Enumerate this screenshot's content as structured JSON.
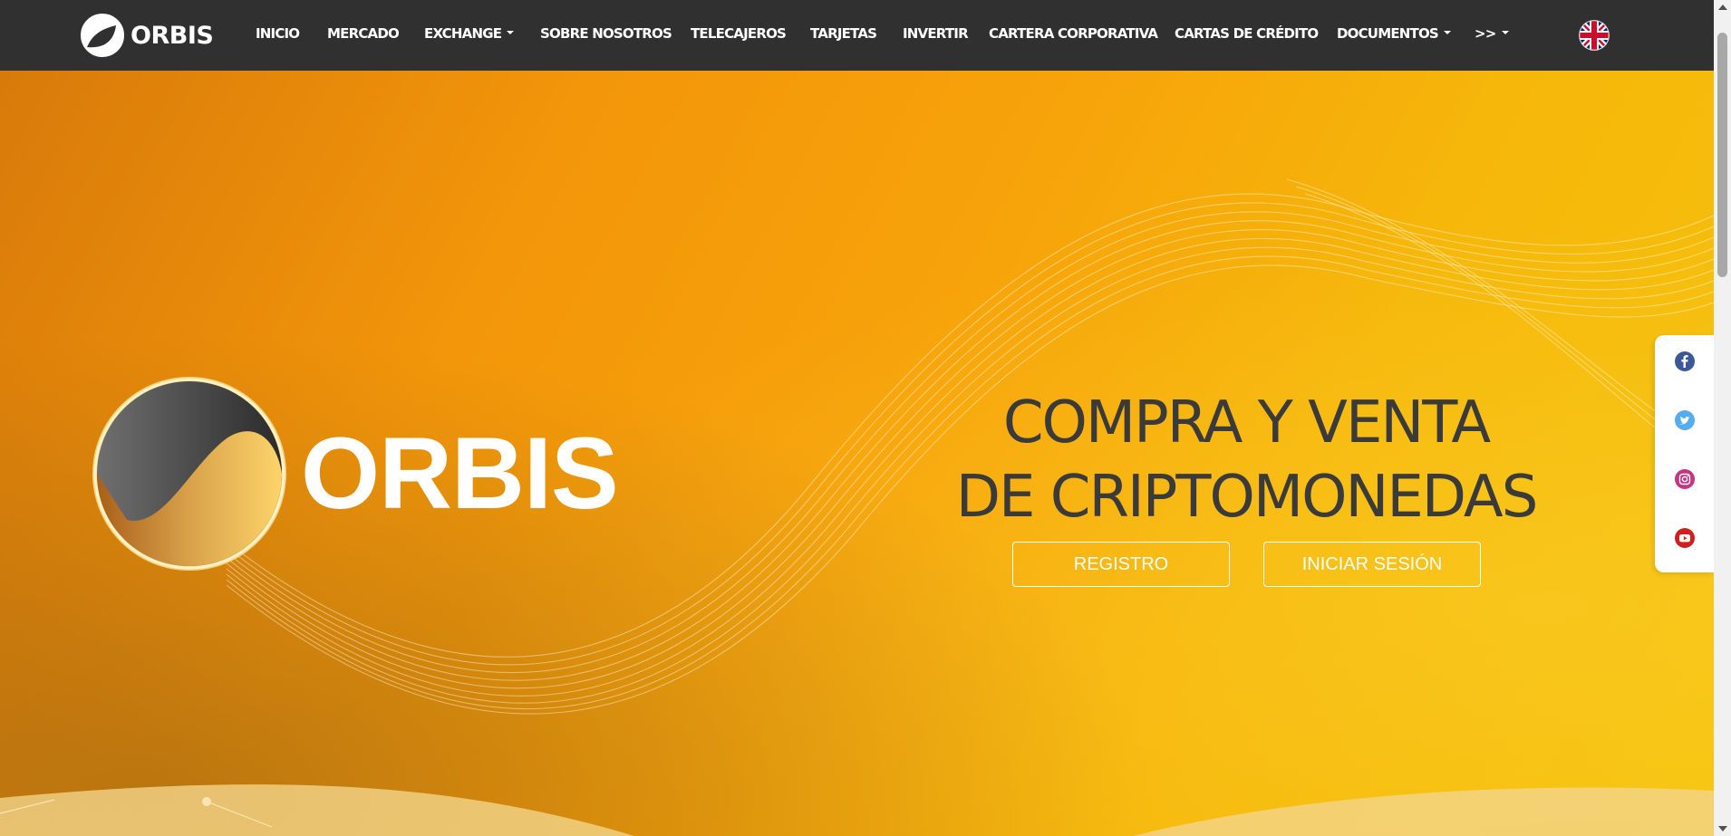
{
  "brand": {
    "name": "ORBIS",
    "logo_icon": "orbis-logo-icon"
  },
  "nav": {
    "items": [
      {
        "label": "INICIO",
        "dropdown": false
      },
      {
        "label": "MERCADO",
        "dropdown": false
      },
      {
        "label": "EXCHANGE",
        "dropdown": true
      },
      {
        "label": "SOBRE NOSOTROS",
        "dropdown": false
      },
      {
        "label": "TELECAJEROS",
        "dropdown": false
      },
      {
        "label": "TARJETAS",
        "dropdown": false
      },
      {
        "label": "INVERTIR",
        "dropdown": false
      },
      {
        "label": "CARTERA CORPORATIVA",
        "dropdown": false
      },
      {
        "label": "CARTAS DE CRÉDITO",
        "dropdown": false
      },
      {
        "label": "DOCUMENTOS",
        "dropdown": true
      },
      {
        "label": ">>",
        "dropdown": true
      }
    ],
    "language_icon": "uk-flag-icon"
  },
  "hero": {
    "logo_word": "ORBIS",
    "headline_line1": "COMPRA Y VENTA",
    "headline_line2": "DE CRIPTOMONEDAS",
    "register_label": "REGISTRO",
    "login_label": "INICIAR SESIÓN"
  },
  "social": [
    {
      "icon": "facebook-icon",
      "color": "#3b5998"
    },
    {
      "icon": "twitter-icon",
      "color": "#55acee"
    },
    {
      "icon": "instagram-icon",
      "color": "#c13584"
    },
    {
      "icon": "youtube-icon",
      "color": "#cd201f"
    }
  ],
  "colors": {
    "navbar": "#303030",
    "hero_orange": "#f3960a",
    "hero_yellow": "#f5c30c",
    "headline_text": "#3a3a3a"
  }
}
